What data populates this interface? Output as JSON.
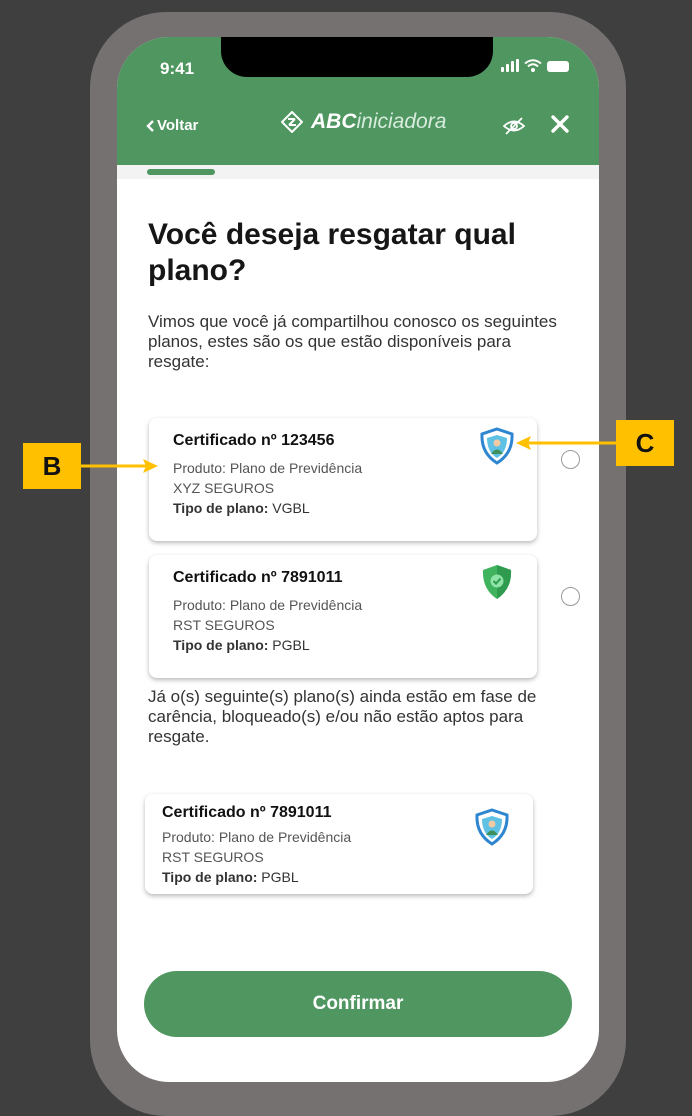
{
  "status_bar": {
    "time": "9:41"
  },
  "header": {
    "back_label": "Voltar",
    "brand_bold": "ABC",
    "brand_light": "iniciadora",
    "colors": {
      "brand_green": "#4f9660",
      "white": "#ffffff"
    }
  },
  "main": {
    "title": "Você deseja resgatar qual plano?",
    "intro": "Vimos que você já compartilhou conosco os seguintes planos, estes são os que estão disponíveis para resgate:",
    "available_plans": [
      {
        "title": "Certificado nº 123456",
        "product": "Produto: Plano de Previdência",
        "insurer": "XYZ SEGUROS",
        "type_label": "Tipo de plano:",
        "type_value": "VGBL",
        "icon": "shield-person-icon",
        "selected": false
      },
      {
        "title": "Certificado nº 7891011",
        "product": "Produto: Plano de Previdência",
        "insurer": "RST SEGUROS",
        "type_label": "Tipo de plano:",
        "type_value": "PGBL",
        "icon": "shield-check-icon",
        "selected": false
      }
    ],
    "notice": "Já o(s) seguinte(s) plano(s) ainda estão em fase de carência, bloqueado(s) e/ou não estão aptos para resgate.",
    "unavailable_plans": [
      {
        "title": "Certificado nº 7891011",
        "product": "Produto: Plano de Previdência",
        "insurer": "RST SEGUROS",
        "type_label": "Tipo de plano:",
        "type_value": "PGBL",
        "icon": "shield-person-icon"
      }
    ],
    "confirm_label": "Confirmar"
  },
  "annotations": {
    "b_label": "B",
    "c_label": "C",
    "color": "#ffc000"
  }
}
